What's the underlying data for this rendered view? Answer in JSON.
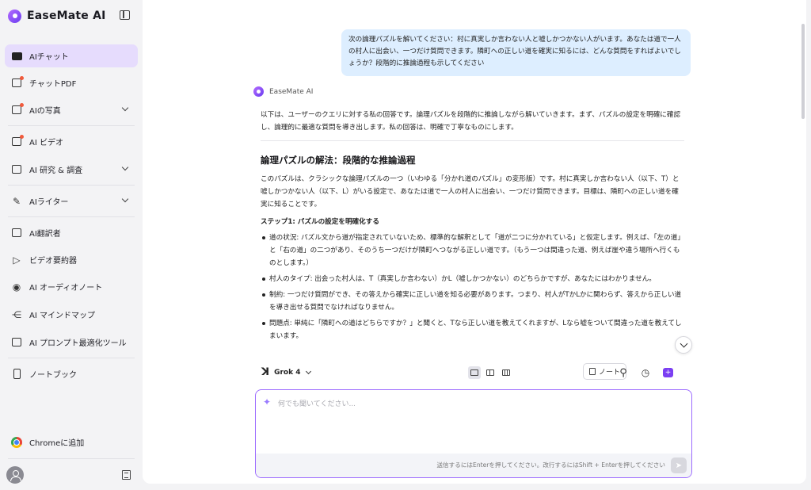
{
  "app": {
    "name": "EaseMate AI"
  },
  "sidebar": {
    "items": [
      {
        "label": "AIチャット",
        "icon": "chat-icon"
      },
      {
        "label": "チャットPDF",
        "icon": "pdf-icon"
      },
      {
        "label": "AIの写真",
        "icon": "photo-icon"
      },
      {
        "label": "AI ビデオ",
        "icon": "video-icon"
      },
      {
        "label": "AI 研究 & 調査",
        "icon": "research-icon"
      },
      {
        "label": "AIライター",
        "icon": "writer-icon"
      },
      {
        "label": "AI翻訳者",
        "icon": "translate-icon"
      },
      {
        "label": "ビデオ要約器",
        "icon": "video-summary-icon"
      },
      {
        "label": "AI オーディオノート",
        "icon": "audio-icon"
      },
      {
        "label": "AI マインドマップ",
        "icon": "mindmap-icon"
      },
      {
        "label": "AI プロンプト最適化ツール",
        "icon": "prompt-icon"
      },
      {
        "label": "ノートブック",
        "icon": "notebook-icon"
      }
    ],
    "chrome_label": "Chromeに追加"
  },
  "chat": {
    "user_message": "次の論理パズルを解いてください：村に真実しか言わない人と嘘しかつかない人がいます。あなたは道で一人の村人に出会い、一つだけ質問できます。隣町への正しい道を確実に知るには、どんな質問をすればよいでしょうか？段階的に推論過程も示してください",
    "bot_name": "EaseMate AI",
    "intro": "以下は、ユーザーのクエリに対する私の回答です。論理パズルを段階的に推論しながら解いていきます。まず、パズルの設定を明確に確認し、論理的に最適な質問を導き出します。私の回答は、明確で丁寧なものにします。",
    "heading": "論理パズルの解法：段階的な推論過程",
    "paragraph": "このパズルは、クラシックな論理パズルの一つ（いわゆる「分かれ道のパズル」の変形版）です。村に真実しか言わない人（以下、T）と嘘しかつかない人（以下、L）がいる設定で、あなたは道で一人の村人に出会い、一つだけ質問できます。目標は、隣町への正しい道を確実に知ることです。",
    "step1_title": "ステップ1: パズルの設定を明確化する",
    "bullets": [
      "道の状況: パズル文から道が指定されていないため、標準的な解釈として「道が二つに分かれている」と仮定します。例えば、「左の道」と「右の道」の二つがあり、そのうち一つだけが隣町へつながる正しい道です。（もう一つは間違った道、例えば崖や違う場所へ行くものとします。）",
      "村人のタイプ: 出会った村人は、T（真実しか言わない）かL（嘘しかつかない）のどちらかですが、あなたにはわかりません。",
      "制約: 一つだけ質問ができ、その答えから確実に正しい道を知る必要があります。つまり、村人がTかLかに関わらず、答えから正しい道を導き出せる質問でなければなりません。",
      "問題点: 単純に「隣町への道はどちらですか？」と聞くと、Tなら正しい道を教えてくれますが、Lなら嘘をついて間違った道を教えてしまいます。"
    ]
  },
  "toolbar": {
    "model": "Grok 4",
    "note_label": "ノート"
  },
  "composer": {
    "placeholder": "何でも聞いてください...",
    "hint": "送信するにはEnterを押してください。改行するにはShift + Enterを押してください"
  }
}
